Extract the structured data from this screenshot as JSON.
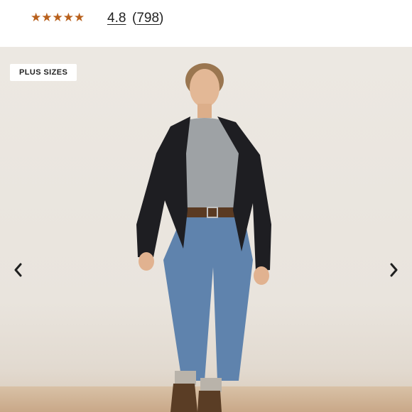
{
  "rating": {
    "stars": "★★★★★",
    "value": "4.8",
    "count_open": "(",
    "count": "798",
    "count_close": ")",
    "star_color": "#b8601c"
  },
  "gallery": {
    "badge": "PLUS SIZES",
    "prev_icon": "chevron-left-icon",
    "next_icon": "chevron-right-icon"
  }
}
